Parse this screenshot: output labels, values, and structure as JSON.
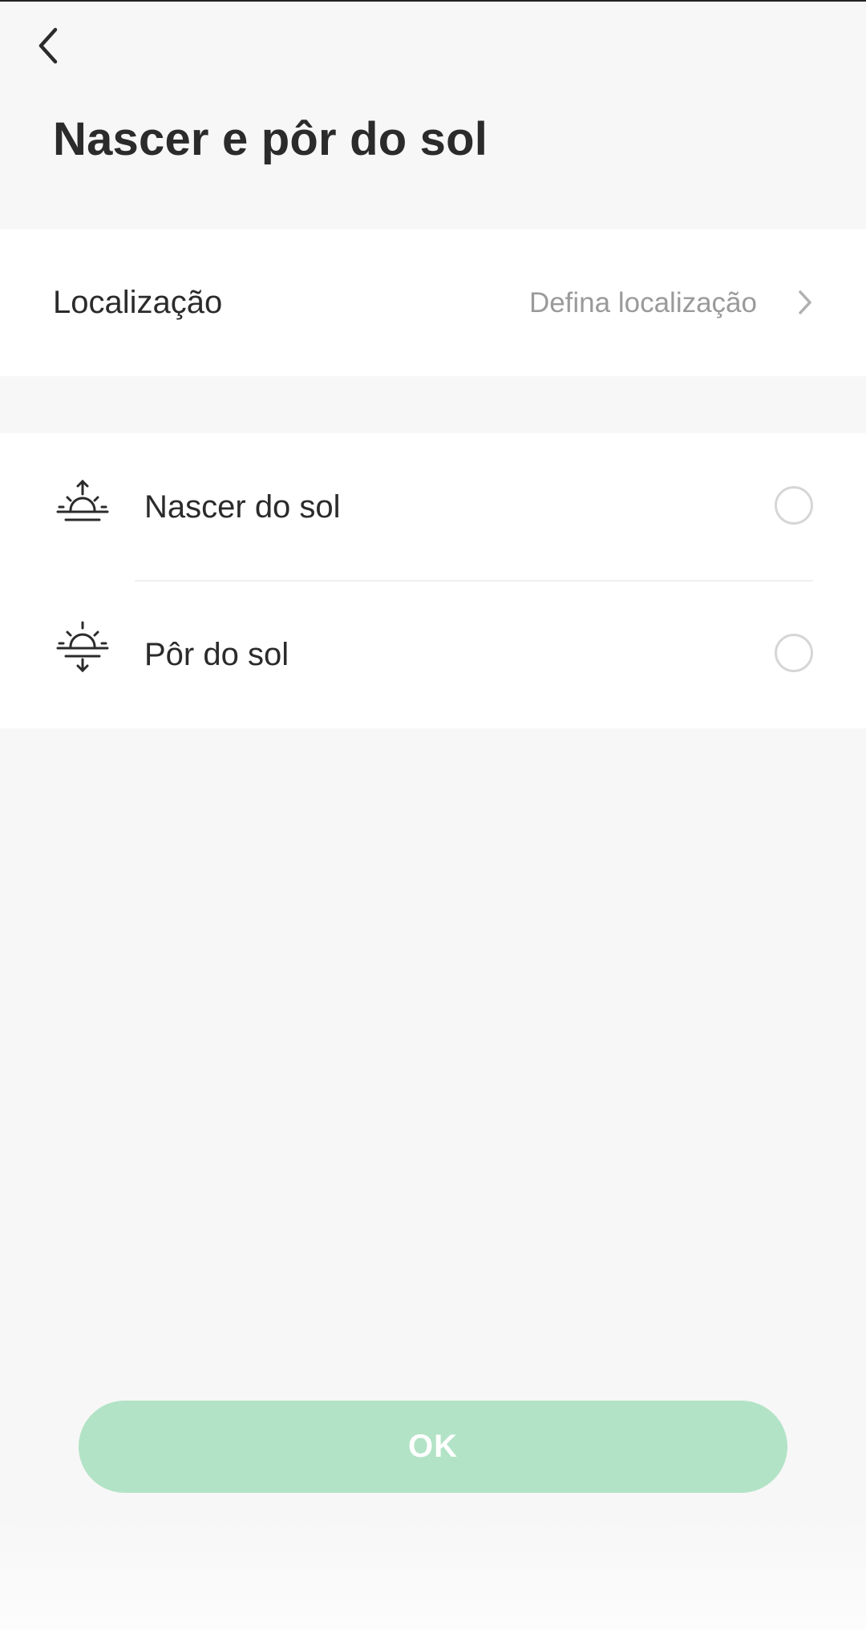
{
  "header": {
    "back_icon": "chevron-left-icon",
    "title": "Nascer e pôr do sol"
  },
  "location": {
    "label": "Localização",
    "value": "Defina localização",
    "chevron_icon": "chevron-right-icon"
  },
  "options": [
    {
      "label": "Nascer do sol",
      "icon": "sunrise-icon",
      "selected": false
    },
    {
      "label": "Pôr do sol",
      "icon": "sunset-icon",
      "selected": false
    }
  ],
  "ok_button": {
    "label": "OK",
    "color": "#b2e3c6"
  }
}
